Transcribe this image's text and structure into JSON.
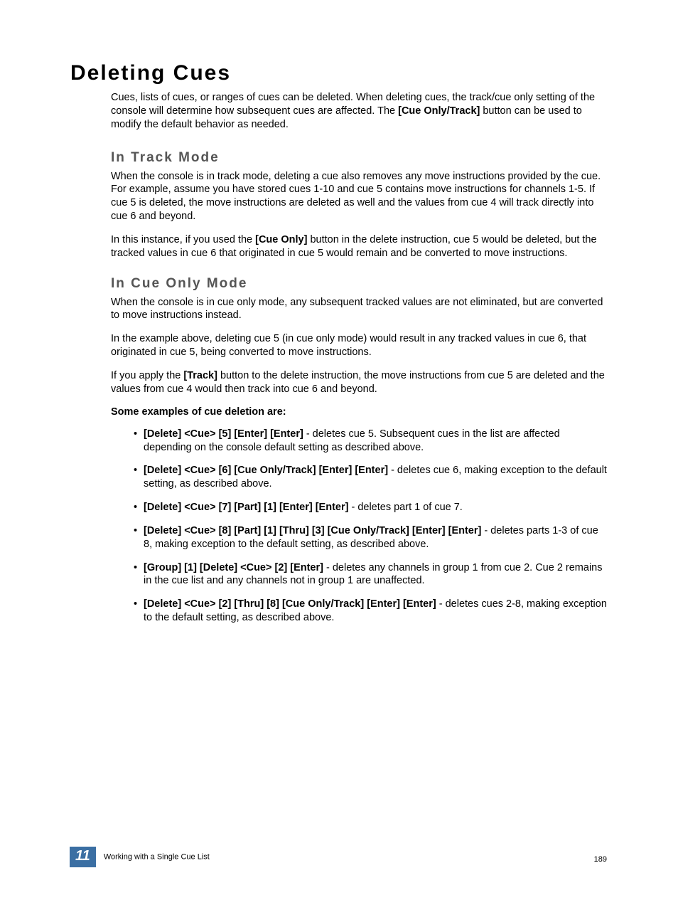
{
  "title": "Deleting Cues",
  "intro_parts": [
    "Cues, lists of cues, or ranges of cues can be deleted. When deleting cues, the track/cue only setting of the console will determine how subsequent cues are affected. The ",
    "[Cue Only/Track]",
    " button can be used to modify the default behavior as needed."
  ],
  "track": {
    "heading": "In Track Mode",
    "p1": "When the console is in track mode, deleting a cue also removes any move instructions provided by the cue. For example, assume you have stored cues 1-10 and cue 5 contains move instructions for channels 1-5. If cue 5 is deleted, the move instructions are deleted as well and the values from cue 4 will track directly into cue 6 and beyond.",
    "p2": [
      "In this instance, if you used the ",
      "[Cue Only]",
      " button in the delete instruction, cue 5 would be deleted, but the tracked values in cue 6 that originated in cue 5 would remain and be converted to move instructions."
    ]
  },
  "cueonly": {
    "heading": "In Cue Only Mode",
    "p1": "When the console is in cue only mode, any subsequent tracked values are not eliminated, but are converted to move instructions instead.",
    "p2": "In the example above, deleting cue 5 (in cue only mode) would result in any tracked values in cue 6, that originated in cue 5, being converted to move instructions.",
    "p3": [
      "If you apply the ",
      "[Track]",
      " button to the delete instruction, the move instructions from cue 5 are deleted and the values from cue 4 would then track into cue 6 and beyond."
    ]
  },
  "examples_heading": "Some examples of cue deletion are:",
  "examples": [
    {
      "cmd": "[Delete] <Cue> [5] [Enter] [Enter]",
      "desc": " - deletes cue 5. Subsequent cues in the list are affected depending on the console default setting as described above."
    },
    {
      "cmd": "[Delete] <Cue> [6] [Cue Only/Track] [Enter] [Enter]",
      "desc": " - deletes cue 6, making exception to the default setting, as described above."
    },
    {
      "cmd": "[Delete] <Cue> [7] [Part] [1] [Enter] [Enter]",
      "desc": " - deletes part 1 of cue 7."
    },
    {
      "cmd": "[Delete] <Cue> [8] [Part] [1] [Thru] [3] [Cue Only/Track] [Enter] [Enter]",
      "desc": " - deletes parts 1-3 of cue 8, making exception to the default setting, as described above."
    },
    {
      "cmd": "[Group] [1] [Delete] <Cue> [2] [Enter]",
      "desc": " - deletes any channels in group 1 from cue 2. Cue 2 remains in the cue list and any channels not in group 1 are unaffected."
    },
    {
      "cmd": "[Delete] <Cue> [2] [Thru] [8] [Cue Only/Track] [Enter] [Enter]",
      "desc": " - deletes cues 2-8, making exception to the default setting, as described above."
    }
  ],
  "footer": {
    "chapter_number": "11",
    "chapter_title": "Working with a Single Cue List",
    "page_number": "189"
  }
}
